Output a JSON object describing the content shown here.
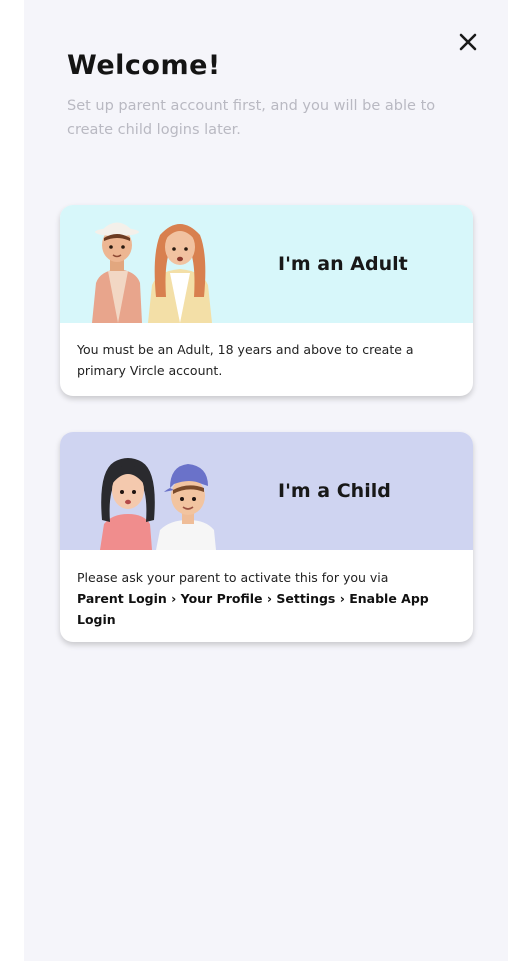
{
  "header": {
    "title": "Welcome!",
    "subtitle": "Set up parent account first, and you will be able to create child logins later.",
    "close_icon": "close-icon"
  },
  "options": {
    "adult": {
      "heading": "I'm an Adult",
      "description": "You must be an Adult, 18 years and above to create a primary Vircle account.",
      "illustration": "adult-couple-illustration",
      "color": "#d7f7fa"
    },
    "child": {
      "heading": "I'm a Child",
      "description_prefix": "Please ask your parent to activate this for you via",
      "description_path": "Parent Login › Your Profile › Settings › Enable App Login",
      "illustration": "children-illustration",
      "color": "#cfd4f1"
    }
  }
}
